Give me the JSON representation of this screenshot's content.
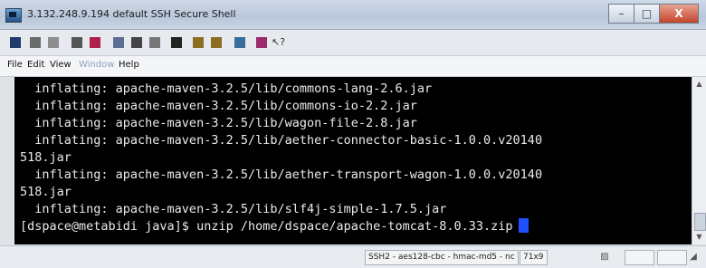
{
  "window": {
    "title": "3.132.248.9.194   default   SSH Secure Shell"
  },
  "title_buttons": {
    "minimize": "–",
    "maximize": "□",
    "close": "X"
  },
  "menu": {
    "items": [
      "File",
      "Edit",
      "View",
      "Window",
      "Help"
    ]
  },
  "toolbar_icons": [
    "save-icon",
    "print-icon",
    "print-preview-icon",
    "quick-connect-icon",
    "profiles-icon",
    "cut-icon",
    "copy-icon",
    "paste-icon",
    "find-icon",
    "file-transfer-icon",
    "new-window-icon",
    "settings-icon",
    "help-icon",
    "context-help-icon"
  ],
  "terminal": {
    "lines": [
      "  inflating: apache-maven-3.2.5/lib/commons-lang-2.6.jar",
      "  inflating: apache-maven-3.2.5/lib/commons-io-2.2.jar",
      "  inflating: apache-maven-3.2.5/lib/wagon-file-2.8.jar",
      "  inflating: apache-maven-3.2.5/lib/aether-connector-basic-1.0.0.v20140",
      "518.jar",
      "  inflating: apache-maven-3.2.5/lib/aether-transport-wagon-1.0.0.v20140",
      "518.jar",
      "  inflating: apache-maven-3.2.5/lib/slf4j-simple-1.7.5.jar",
      "[dspace@metabidi java]$ unzip /home/dspace/apache-tomcat-8.0.33.zip"
    ]
  },
  "status": {
    "connection": "SSH2 - aes128-cbc - hmac-md5 - nc",
    "size": "71x9"
  },
  "colors": {
    "terminal_bg": "#000000",
    "terminal_fg": "#eaeaea",
    "cursor": "#1f4fff"
  }
}
